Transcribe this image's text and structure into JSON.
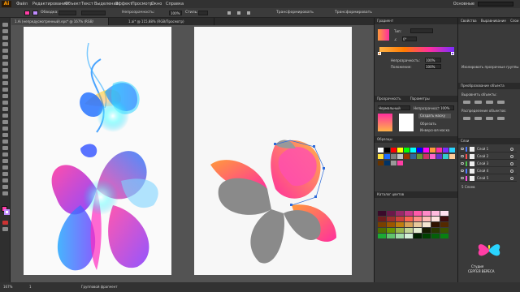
{
  "app": {
    "logo": "Ai"
  },
  "menu": [
    "Файл",
    "Редактирование",
    "Объект",
    "Текст",
    "Выделение",
    "Эффект",
    "Просмотр",
    "Окно",
    "Справка"
  ],
  "workspace": "Основные",
  "control_bar": {
    "stroke_label": "Обводка:",
    "opacity_label": "Непрозрачность:",
    "opacity_value": "100%",
    "style_label": "Стиль:",
    "transform_label": "Трансформировать",
    "fill_color": "#ff3ea5",
    "stroke_color": "#c08cff"
  },
  "tabs": [
    {
      "label": "1.Ai (непредусмотренный).eps* @ 167% (RGB/Просмотр)",
      "active": true
    },
    {
      "label": "1.ai* @ 115,88% (RGB/Просмотр)",
      "active": false
    }
  ],
  "status": {
    "zoom": "167%",
    "page": "1",
    "tool": "Групповой фрагмент"
  },
  "gradient_panel": {
    "title": "Градиент",
    "type_label": "Тип:",
    "angle_label": "∠",
    "angle_value": "0°",
    "opacity_label": "Непрозрачность:",
    "opacity_value": "100%",
    "location_label": "Положение:",
    "location_value": "100%"
  },
  "transparency_panel": {
    "tab1": "Прозрачность",
    "tab2": "Параметры",
    "mode": "Нормальный",
    "opacity_label": "Непрозрачность:",
    "opacity_value": "100%",
    "make_mask": "Создать маску",
    "clip": "Обрезать",
    "invert": "Инверсная маска"
  },
  "swatches_panel": {
    "title": "Образцы"
  },
  "color_guide": {
    "title": "Каталог цветов"
  },
  "right_panel": {
    "tabs": [
      "Свойства",
      "Выравнивание",
      "Слои"
    ],
    "isolate": "Изолировать прозрачные группы",
    "appearance_tab": "Преобразование объекта",
    "align_label": "Выровнять объекты:",
    "distribute_label": "Распределение объектов:",
    "layers_title": "Слои",
    "layers": [
      {
        "name": "Слой 1",
        "color": "#4e7bff"
      },
      {
        "name": "Слой 2",
        "color": "#ff4e4e"
      },
      {
        "name": "Слой 3",
        "color": "#4ec24e"
      },
      {
        "name": "Слой 4",
        "color": "#4e7bff"
      },
      {
        "name": "Слой 5",
        "color": "#ff4ee0"
      }
    ],
    "layers_count": "5 Слоев"
  },
  "watermark": {
    "line1": "Студия",
    "line2": "СЕРГЕЯ ВЕРЕСА"
  }
}
